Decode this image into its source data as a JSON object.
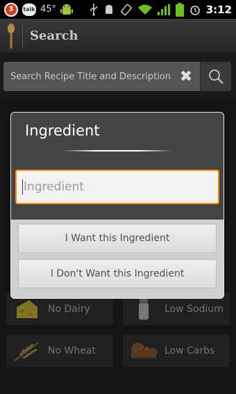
{
  "status_bar": {
    "notification_count": "3",
    "talk_label": "talk",
    "temperature": "45°",
    "time": "3:12",
    "icons": [
      "notification-badge-icon",
      "talk-icon",
      "android-icon",
      "usb-icon",
      "android-debug-icon",
      "rotate-icon",
      "wifi-icon",
      "signal-icon",
      "battery-icon",
      "alarm-icon"
    ]
  },
  "app_bar": {
    "title": "Search",
    "logo_icon": "wooden-spoon-icon"
  },
  "search": {
    "placeholder": "Search Recipe Title and Description",
    "clear_icon": "close-icon",
    "search_icon": "magnifier-icon"
  },
  "filters": [
    {
      "label": "No Dairy",
      "icon": "cheese-icon"
    },
    {
      "label": "Low Sodium",
      "icon": "salt-shaker-icon"
    },
    {
      "label": "No Wheat",
      "icon": "wheat-icon"
    },
    {
      "label": "Low Carbs",
      "icon": "bread-icon"
    }
  ],
  "dialog": {
    "title": "Ingredient",
    "input_placeholder": "Ingredient",
    "want_button": "I Want this Ingredient",
    "dont_want_button": "I Don't Want this Ingredient"
  },
  "colors": {
    "accent_focus": "#f08c00",
    "dialog_header": "#444444",
    "app_bar": "#2e2e2e"
  }
}
